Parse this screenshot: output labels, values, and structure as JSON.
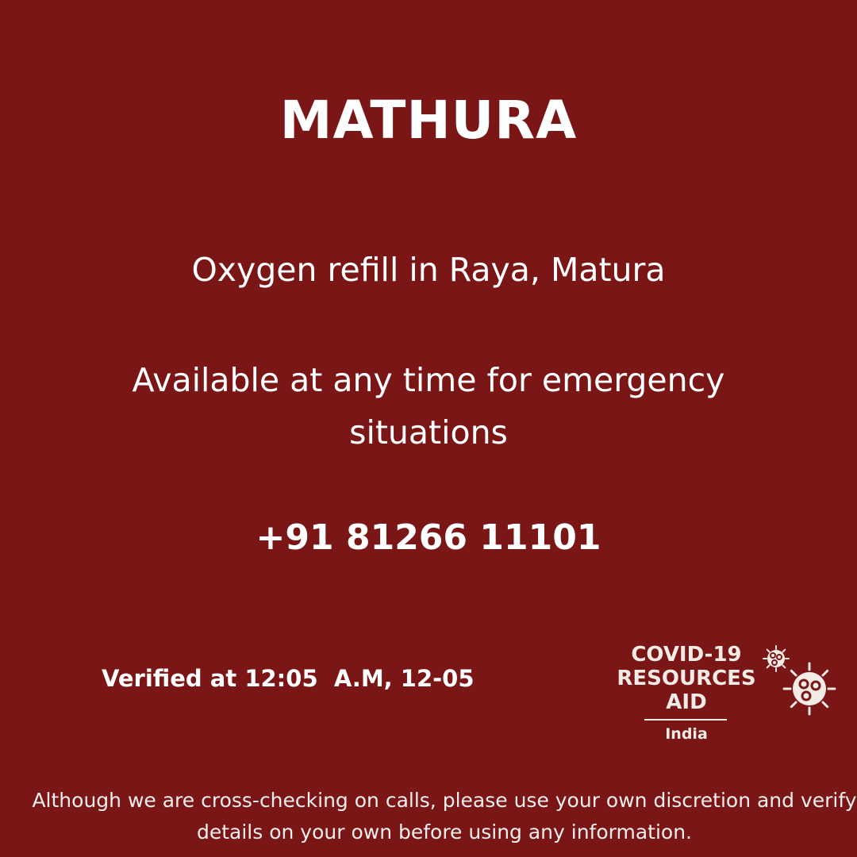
{
  "colors": {
    "background": "#7b1616",
    "text": "#ffffff",
    "logo": "#f2ebe6"
  },
  "post": {
    "city": "MATHURA",
    "resource": "Oxygen refill in Raya, Matura",
    "availability": "Available at any time for emergency situations",
    "phone": "+91 81266 11101",
    "verified": "Verified at 12:05  A.M, 12-05"
  },
  "logo": {
    "line1": "COVID-19",
    "line2": "RESOURCES",
    "line3": "AID",
    "country": "India",
    "icon": "virus-icon"
  },
  "disclaimer": "Although we are cross-checking on calls, please use your own discretion and verify details on your own before using any information."
}
